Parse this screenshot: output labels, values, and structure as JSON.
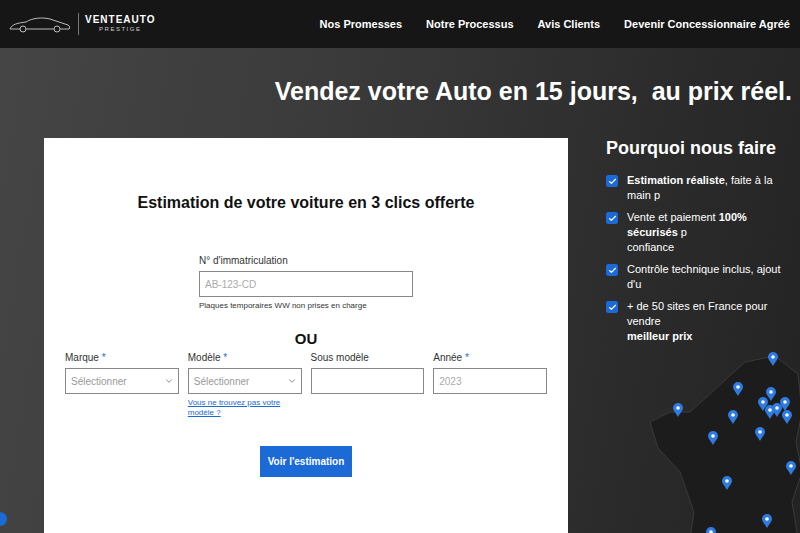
{
  "header": {
    "logo": {
      "name": "VENTEAUTO",
      "tagline": "PRESTIGE"
    },
    "nav": [
      "Nos Promesses",
      "Notre Processus",
      "Avis Clients",
      "Devenir Concessionnaire Agréé"
    ]
  },
  "hero": {
    "title": "Vendez votre Auto en 15 jours,  au prix réel."
  },
  "estimate_form": {
    "title": "Estimation de votre voiture en 3 clics offerte",
    "plate": {
      "label": "N° d'immatriculation",
      "placeholder": "AB-123-CD",
      "hint": "Plaques temporaires WW non prises en charge"
    },
    "separator": "OU",
    "required_mark": "*",
    "fields": [
      {
        "label": "Marque",
        "required": true,
        "kind": "select",
        "placeholder": "Sélectionner",
        "link": ""
      },
      {
        "label": "Modèle",
        "required": true,
        "kind": "select",
        "placeholder": "Sélectionner",
        "link": "Vous ne trouvez pas votre modèle ?"
      },
      {
        "label": "Sous modèle",
        "required": false,
        "kind": "text",
        "placeholder": "",
        "link": ""
      },
      {
        "label": "Année",
        "required": true,
        "kind": "text",
        "placeholder": "2023",
        "link": ""
      }
    ],
    "submit": "Voir l'estimation"
  },
  "benefits": {
    "title": "Pourquoi nous faire",
    "items": [
      {
        "checked": true,
        "lines": [
          [
            {
              "text": "Estimation réaliste",
              "bold": true
            },
            {
              "text": ", faite à la main p",
              "bold": false
            }
          ]
        ]
      },
      {
        "checked": true,
        "lines": [
          [
            {
              "text": "Vente et paiement ",
              "bold": false
            },
            {
              "text": "100% sécurisés",
              "bold": true
            },
            {
              "text": " p",
              "bold": false
            }
          ],
          [
            {
              "text": "confiance",
              "bold": false
            }
          ]
        ]
      },
      {
        "checked": true,
        "lines": [
          [
            {
              "text": "Contrôle technique inclus, ajout d'u",
              "bold": false
            }
          ]
        ]
      },
      {
        "checked": true,
        "lines": [
          [
            {
              "text": "+ de 50 sites en France pour vendre",
              "bold": false
            }
          ],
          [
            {
              "text": "meilleur prix",
              "bold": true
            }
          ]
        ]
      }
    ]
  }
}
